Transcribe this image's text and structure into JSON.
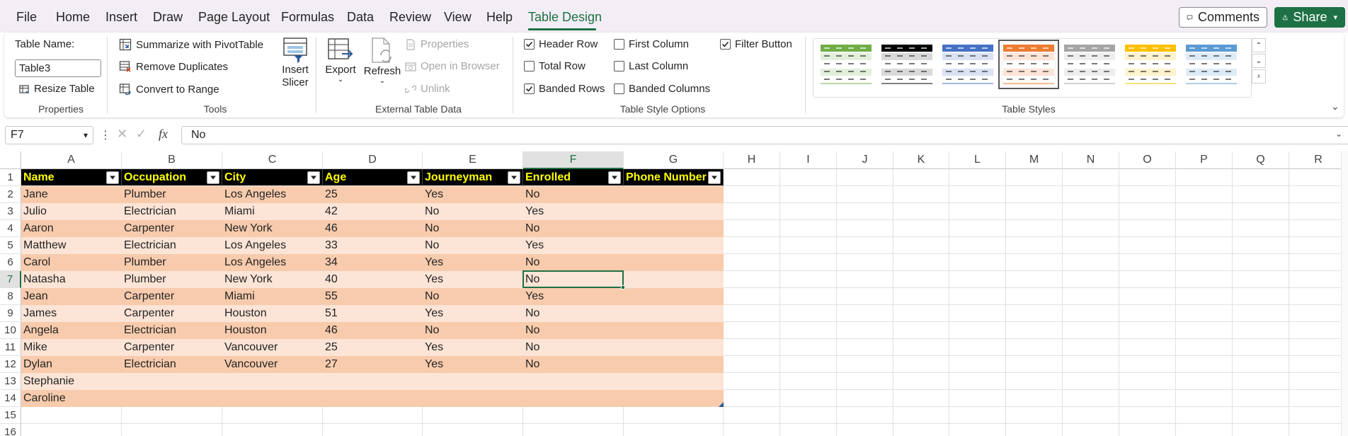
{
  "menu": {
    "items": [
      "File",
      "Home",
      "Insert",
      "Draw",
      "Page Layout",
      "Formulas",
      "Data",
      "Review",
      "View",
      "Help",
      "Table Design"
    ],
    "active": "Table Design",
    "comments_label": "Comments",
    "share_label": "Share"
  },
  "ribbon": {
    "properties": {
      "table_name_label": "Table Name:",
      "table_name_value": "Table3",
      "resize_label": "Resize Table",
      "group_label": "Properties"
    },
    "tools": {
      "pivot_label": "Summarize with PivotTable",
      "remove_dup_label": "Remove Duplicates",
      "convert_label": "Convert to Range",
      "slicer_label_1": "Insert",
      "slicer_label_2": "Slicer",
      "group_label": "Tools"
    },
    "external": {
      "export_label": "Export",
      "refresh_label": "Refresh",
      "properties_label": "Properties",
      "open_browser_label": "Open in Browser",
      "unlink_label": "Unlink",
      "group_label": "External Table Data"
    },
    "style_options": {
      "header_row": {
        "label": "Header Row",
        "checked": true
      },
      "total_row": {
        "label": "Total Row",
        "checked": false
      },
      "banded_rows": {
        "label": "Banded Rows",
        "checked": true
      },
      "first_column": {
        "label": "First Column",
        "checked": false
      },
      "last_column": {
        "label": "Last Column",
        "checked": false
      },
      "banded_columns": {
        "label": "Banded Columns",
        "checked": false
      },
      "filter_button": {
        "label": "Filter Button",
        "checked": true
      },
      "group_label": "Table Style Options"
    },
    "styles": {
      "group_label": "Table Styles",
      "thumbs": [
        {
          "header": "#70ad47",
          "band": "#e2efda",
          "line": "#70ad47"
        },
        {
          "header": "#000000",
          "band": "#d9d9d9",
          "line": "#000000"
        },
        {
          "header": "#4472c4",
          "band": "#d9e1f2",
          "line": "#4472c4"
        },
        {
          "header": "#ed7d31",
          "band": "#fce4d6",
          "line": "#ed7d31"
        },
        {
          "header": "#a5a5a5",
          "band": "#ededed",
          "line": "#a5a5a5"
        },
        {
          "header": "#ffc000",
          "band": "#fff2cc",
          "line": "#ffc000"
        },
        {
          "header": "#5b9bd5",
          "band": "#ddebf7",
          "line": "#5b9bd5"
        }
      ],
      "selected_index": 3
    }
  },
  "formula_bar": {
    "name_box": "F7",
    "fx_label": "fx",
    "formula": "No"
  },
  "grid": {
    "columns": [
      "A",
      "B",
      "C",
      "D",
      "E",
      "F",
      "G",
      "H",
      "I",
      "J",
      "K",
      "L",
      "M",
      "N",
      "O",
      "P",
      "Q",
      "R"
    ],
    "rows": [
      "1",
      "2",
      "3",
      "4",
      "5",
      "6",
      "7",
      "8",
      "9",
      "10",
      "11",
      "12",
      "13",
      "14",
      "15",
      "16"
    ],
    "active_cell": "F7",
    "active_col_index": 5,
    "active_row_index": 6
  },
  "table": {
    "headers": [
      "Name",
      "Occupation",
      "City",
      "Age",
      "Journeyman",
      "Enrolled",
      "Phone Number"
    ],
    "rows": [
      [
        "Jane",
        "Plumber",
        "Los Angeles",
        "25",
        "Yes",
        "No",
        ""
      ],
      [
        "Julio",
        "Electrician",
        "Miami",
        "42",
        "No",
        "Yes",
        ""
      ],
      [
        "Aaron",
        "Carpenter",
        "New York",
        "46",
        "No",
        "No",
        ""
      ],
      [
        "Matthew",
        "Electrician",
        "Los Angeles",
        "33",
        "No",
        "Yes",
        ""
      ],
      [
        "Carol",
        "Plumber",
        "Los Angeles",
        "34",
        "Yes",
        "No",
        ""
      ],
      [
        "Natasha",
        "Plumber",
        "New York",
        "40",
        "Yes",
        "No",
        ""
      ],
      [
        "Jean",
        "Carpenter",
        "Miami",
        "55",
        "No",
        "Yes",
        ""
      ],
      [
        "James",
        "Carpenter",
        "Houston",
        "51",
        "Yes",
        "No",
        ""
      ],
      [
        "Angela",
        "Electrician",
        "Houston",
        "46",
        "No",
        "No",
        ""
      ],
      [
        "Mike",
        "Carpenter",
        "Vancouver",
        "25",
        "Yes",
        "No",
        ""
      ],
      [
        "Dylan",
        "Electrician",
        "Vancouver",
        "27",
        "Yes",
        "No",
        ""
      ],
      [
        "Stephanie",
        "",
        "",
        "",
        "",
        "",
        ""
      ],
      [
        "Caroline",
        "",
        "",
        "",
        "",
        "",
        ""
      ]
    ]
  },
  "colors": {
    "accent": "#1e7145",
    "header_bg": "#000000",
    "header_text": "#ffff00",
    "band_dark": "#f8cbad",
    "band_light": "#fce4d6"
  }
}
